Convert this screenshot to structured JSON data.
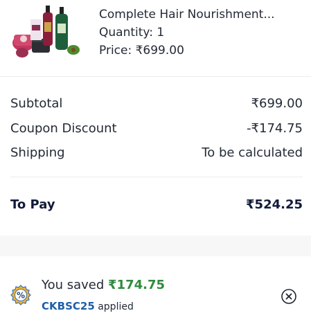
{
  "product": {
    "name": "Complete Hair Nourishment...",
    "quantity": "Quantity: 1",
    "price": "Price: ₹699.00",
    "image_icon": "hair-product-bundle-image"
  },
  "summary": {
    "subtotal_label": "Subtotal",
    "subtotal_value": "₹699.00",
    "coupon_label": "Coupon Discount",
    "coupon_value": "-₹174.75",
    "shipping_label": "Shipping",
    "shipping_value": "To be calculated",
    "topay_label": "To Pay",
    "topay_value": "₹524.25"
  },
  "savings": {
    "prefix": "You saved ",
    "amount": "₹174.75",
    "code": "CKBSC25",
    "suffix": " applied",
    "badge_icon": "percent-badge-icon",
    "close_icon": "close-icon"
  },
  "colors": {
    "saved_green": "#2e8b3d",
    "code_blue": "#1e5fa8",
    "text_dark": "#121a3a"
  }
}
